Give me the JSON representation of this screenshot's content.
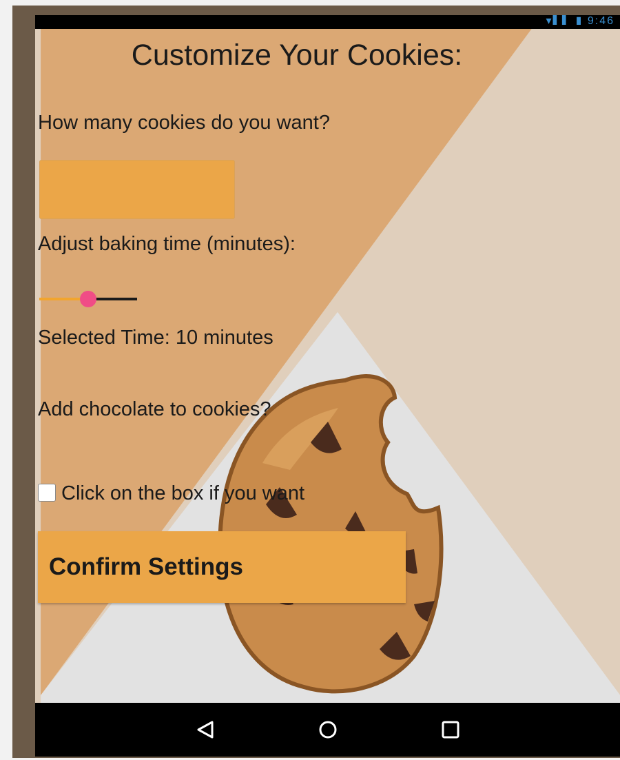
{
  "status_bar": {
    "icons": "▾▌▌ ▮ 9:46"
  },
  "page": {
    "title": "Customize Your Cookies:"
  },
  "form": {
    "count_label": "How many cookies do you want?",
    "count_value": "",
    "baking_label": "Adjust baking time (minutes):",
    "baking_time": {
      "value": 10,
      "min": 0,
      "max": 20
    },
    "selected_time_text": "Selected Time: 10 minutes",
    "chocolate_label": "Add chocolate to cookies?",
    "checkbox_label": "Click on the box if you want",
    "checkbox_checked": false,
    "confirm_label": "Confirm Settings"
  },
  "nav": {
    "back_icon": "back-triangle-icon",
    "home_icon": "home-circle-icon",
    "recents_icon": "recents-square-icon"
  },
  "colors": {
    "accent": "#eba648",
    "slider_fill": "#f2a52e",
    "slider_thumb": "#f04d86",
    "background_tan": "#dba874",
    "background_light": "#e0cfbc",
    "background_grey": "#e2e2e2"
  }
}
